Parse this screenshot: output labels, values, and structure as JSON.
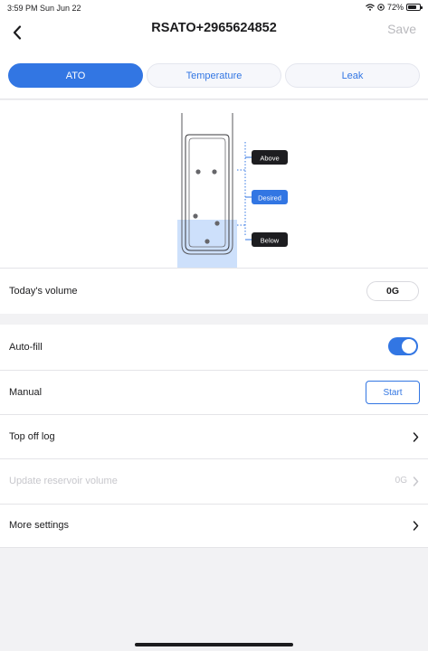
{
  "status_bar": {
    "time_date": "3:59 PM   Sun Jun 22",
    "battery": "72%"
  },
  "nav": {
    "title": "RSATO+2965624852",
    "save_label": "Save"
  },
  "tabs": [
    {
      "label": "ATO",
      "active": true
    },
    {
      "label": "Temperature",
      "active": false
    },
    {
      "label": "Leak",
      "active": false
    }
  ],
  "diagram": {
    "above_label": "Above",
    "desired_label": "Desired",
    "below_label": "Below"
  },
  "volume": {
    "label": "Today's volume",
    "value": "0G"
  },
  "settings": {
    "autofill": {
      "label": "Auto-fill",
      "on": true
    },
    "manual": {
      "label": "Manual",
      "button_label": "Start"
    },
    "topoff_log": {
      "label": "Top off log"
    },
    "update_reservoir": {
      "label": "Update reservoir volume",
      "value": "0G",
      "disabled": true
    },
    "more_settings": {
      "label": "More settings"
    }
  },
  "colors": {
    "accent": "#3276e3",
    "dark_tag": "#1d1d20",
    "water": "#cde0fb"
  }
}
